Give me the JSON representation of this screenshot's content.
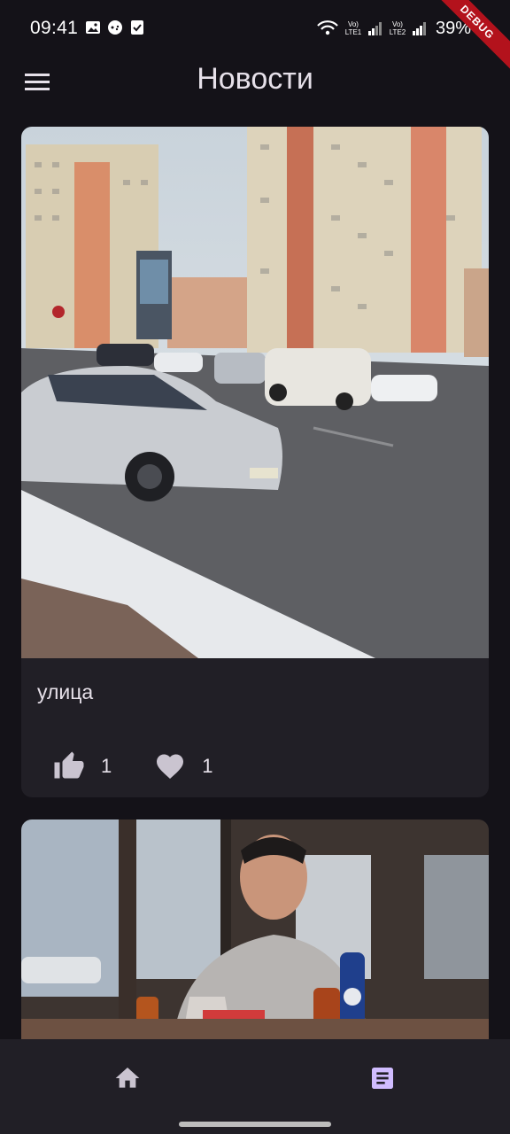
{
  "status_bar": {
    "time": "09:41",
    "battery": "39%",
    "sim1": "Vo) LTE1",
    "sim2": "Vo) LTE2"
  },
  "debug_banner": "DEBUG",
  "app_bar": {
    "title": "Новости",
    "menu_icon": "menu-icon"
  },
  "posts": [
    {
      "caption": "улица",
      "likes": "1",
      "hearts": "1",
      "like_icon": "thumb-up-icon",
      "heart_icon": "heart-icon"
    },
    {
      "caption": "",
      "likes": "",
      "hearts": ""
    }
  ],
  "bottom_nav": {
    "items": [
      {
        "icon": "home-icon",
        "selected": false
      },
      {
        "icon": "news-article-icon",
        "selected": true
      }
    ]
  },
  "colors": {
    "background": "#141218",
    "card": "#211f26",
    "accent": "#d0bcff",
    "ribbon": "#b3121c"
  }
}
